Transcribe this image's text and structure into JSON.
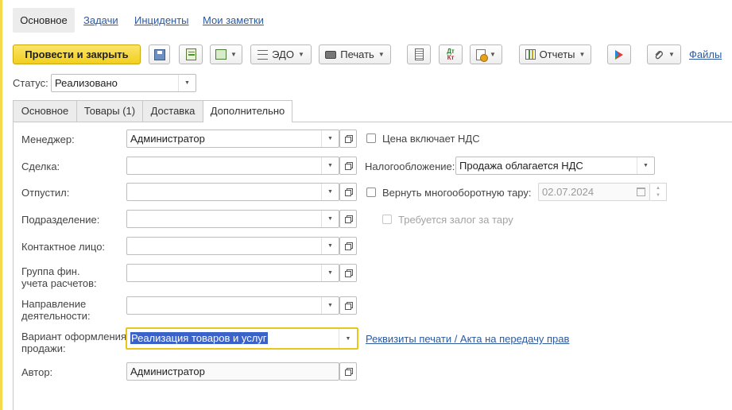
{
  "nav": {
    "items": [
      {
        "label": "Основное",
        "active": true
      },
      {
        "label": "Задачи"
      },
      {
        "label": "Инциденты"
      },
      {
        "label": "Мои заметки"
      }
    ]
  },
  "toolbar": {
    "post_close": "Провести и закрыть",
    "edo": "ЭДО",
    "print": "Печать",
    "reports": "Отчеты",
    "files": "Файлы",
    "dtkt_top": "Дт",
    "dtkt_bottom": "Кт"
  },
  "status": {
    "label": "Статус:",
    "value": "Реализовано"
  },
  "tabs": [
    "Основное",
    "Товары (1)",
    "Доставка",
    "Дополнительно"
  ],
  "form": {
    "manager": {
      "label": "Менеджер:",
      "value": "Администратор"
    },
    "deal": {
      "label": "Сделка:",
      "value": ""
    },
    "shipped_by": {
      "label": "Отпустил:",
      "value": ""
    },
    "department": {
      "label": "Подразделение:",
      "value": ""
    },
    "contact": {
      "label": "Контактное лицо:",
      "value": ""
    },
    "fin_group": {
      "label_line1": "Группа фин.",
      "label_line2": "учета расчетов:",
      "value": ""
    },
    "direction": {
      "label_line1": "Направление",
      "label_line2": "деятельности:",
      "value": ""
    },
    "sale_variant": {
      "label_line1": "Вариант оформления",
      "label_line2": "продажи:",
      "value": "Реализация товаров и услуг"
    },
    "author": {
      "label": "Автор:",
      "value": "Администратор"
    },
    "price_incl_vat": {
      "label": "Цена включает НДС",
      "checked": false
    },
    "taxation": {
      "label": "Налогообложение:",
      "value": "Продажа облагается НДС"
    },
    "return_tare": {
      "label": "Вернуть многооборотную тару:",
      "checked": false,
      "date": "02.07.2024"
    },
    "deposit_required": {
      "label": "Требуется залог за тару",
      "checked": false
    },
    "print_requisites_link": "Реквизиты печати / Акта на передачу прав"
  },
  "colors": {
    "accent": "#f2cf1d",
    "link": "#2c5aa0",
    "focus": "#e8c61a",
    "selection": "#3a62c8"
  }
}
